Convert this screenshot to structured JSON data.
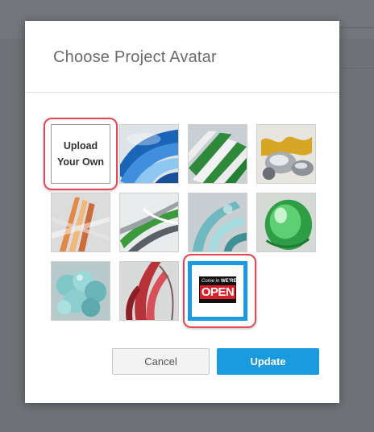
{
  "modal": {
    "title": "Choose Project Avatar"
  },
  "upload_tile": {
    "line1": "Upload",
    "line2": "Your Own"
  },
  "avatars": [
    {
      "name": "blue-ribbons"
    },
    {
      "name": "green-white-stripes"
    },
    {
      "name": "gold-silver-spheres"
    },
    {
      "name": "orange-glass-bundle"
    },
    {
      "name": "green-silver-twist"
    },
    {
      "name": "teal-glass-curls"
    },
    {
      "name": "green-glass-blob"
    },
    {
      "name": "teal-bubble-cluster"
    },
    {
      "name": "red-ribbon-twist"
    },
    {
      "name": "open-sign",
      "selected": true
    }
  ],
  "open_sign": {
    "small_text_left": "Come in",
    "small_text_right": "WE'RE",
    "big_text": "OPEN"
  },
  "buttons": {
    "cancel_label": "Cancel",
    "update_label": "Update"
  },
  "colors": {
    "accent": "#1a9be0",
    "highlight_ring": "#e14a55"
  }
}
